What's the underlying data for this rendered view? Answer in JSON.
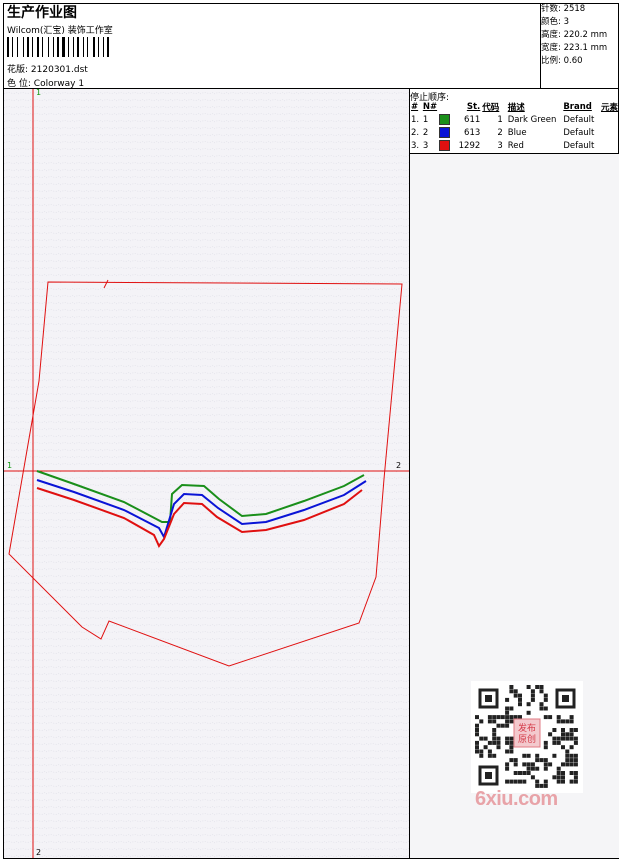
{
  "header": {
    "title": "生产作业图",
    "subtitle": "Wilcom(汇宝) 装饰工作室",
    "design_label": "花版:",
    "design_file": "2120301.dst",
    "colorway_label": "色 位:",
    "colorway": "Colorway 1"
  },
  "stats": [
    {
      "label": "针数:",
      "value": "2518"
    },
    {
      "label": "颜色:",
      "value": "3"
    },
    {
      "label": "高度:",
      "value": "220.2 mm"
    },
    {
      "label": "宽度:",
      "value": "223.1 mm"
    },
    {
      "label": "比例:",
      "value": "0.60"
    }
  ],
  "stop_sequence": {
    "title": "停止顺序:",
    "columns": [
      "#",
      "N#",
      "St.",
      "代码",
      "描述",
      "Brand",
      "元素"
    ],
    "rows": [
      {
        "num": "1.",
        "n": "1",
        "color": "#1a8f1a",
        "stitches": "611",
        "code": "1",
        "desc": "Dark Green",
        "brand": "Default"
      },
      {
        "num": "2.",
        "n": "2",
        "color": "#0a14d6",
        "stitches": "613",
        "code": "2",
        "desc": "Blue",
        "brand": "Default"
      },
      {
        "num": "3.",
        "n": "3",
        "color": "#e01010",
        "stitches": "1292",
        "code": "3",
        "desc": "Red",
        "brand": "Default"
      }
    ]
  },
  "axis_markers": {
    "top": "1",
    "left": "1",
    "right": "2",
    "bottom": "2"
  },
  "qr_stamp": {
    "line1": "发布",
    "line2": "原创"
  },
  "watermark": "6xiu.com"
}
